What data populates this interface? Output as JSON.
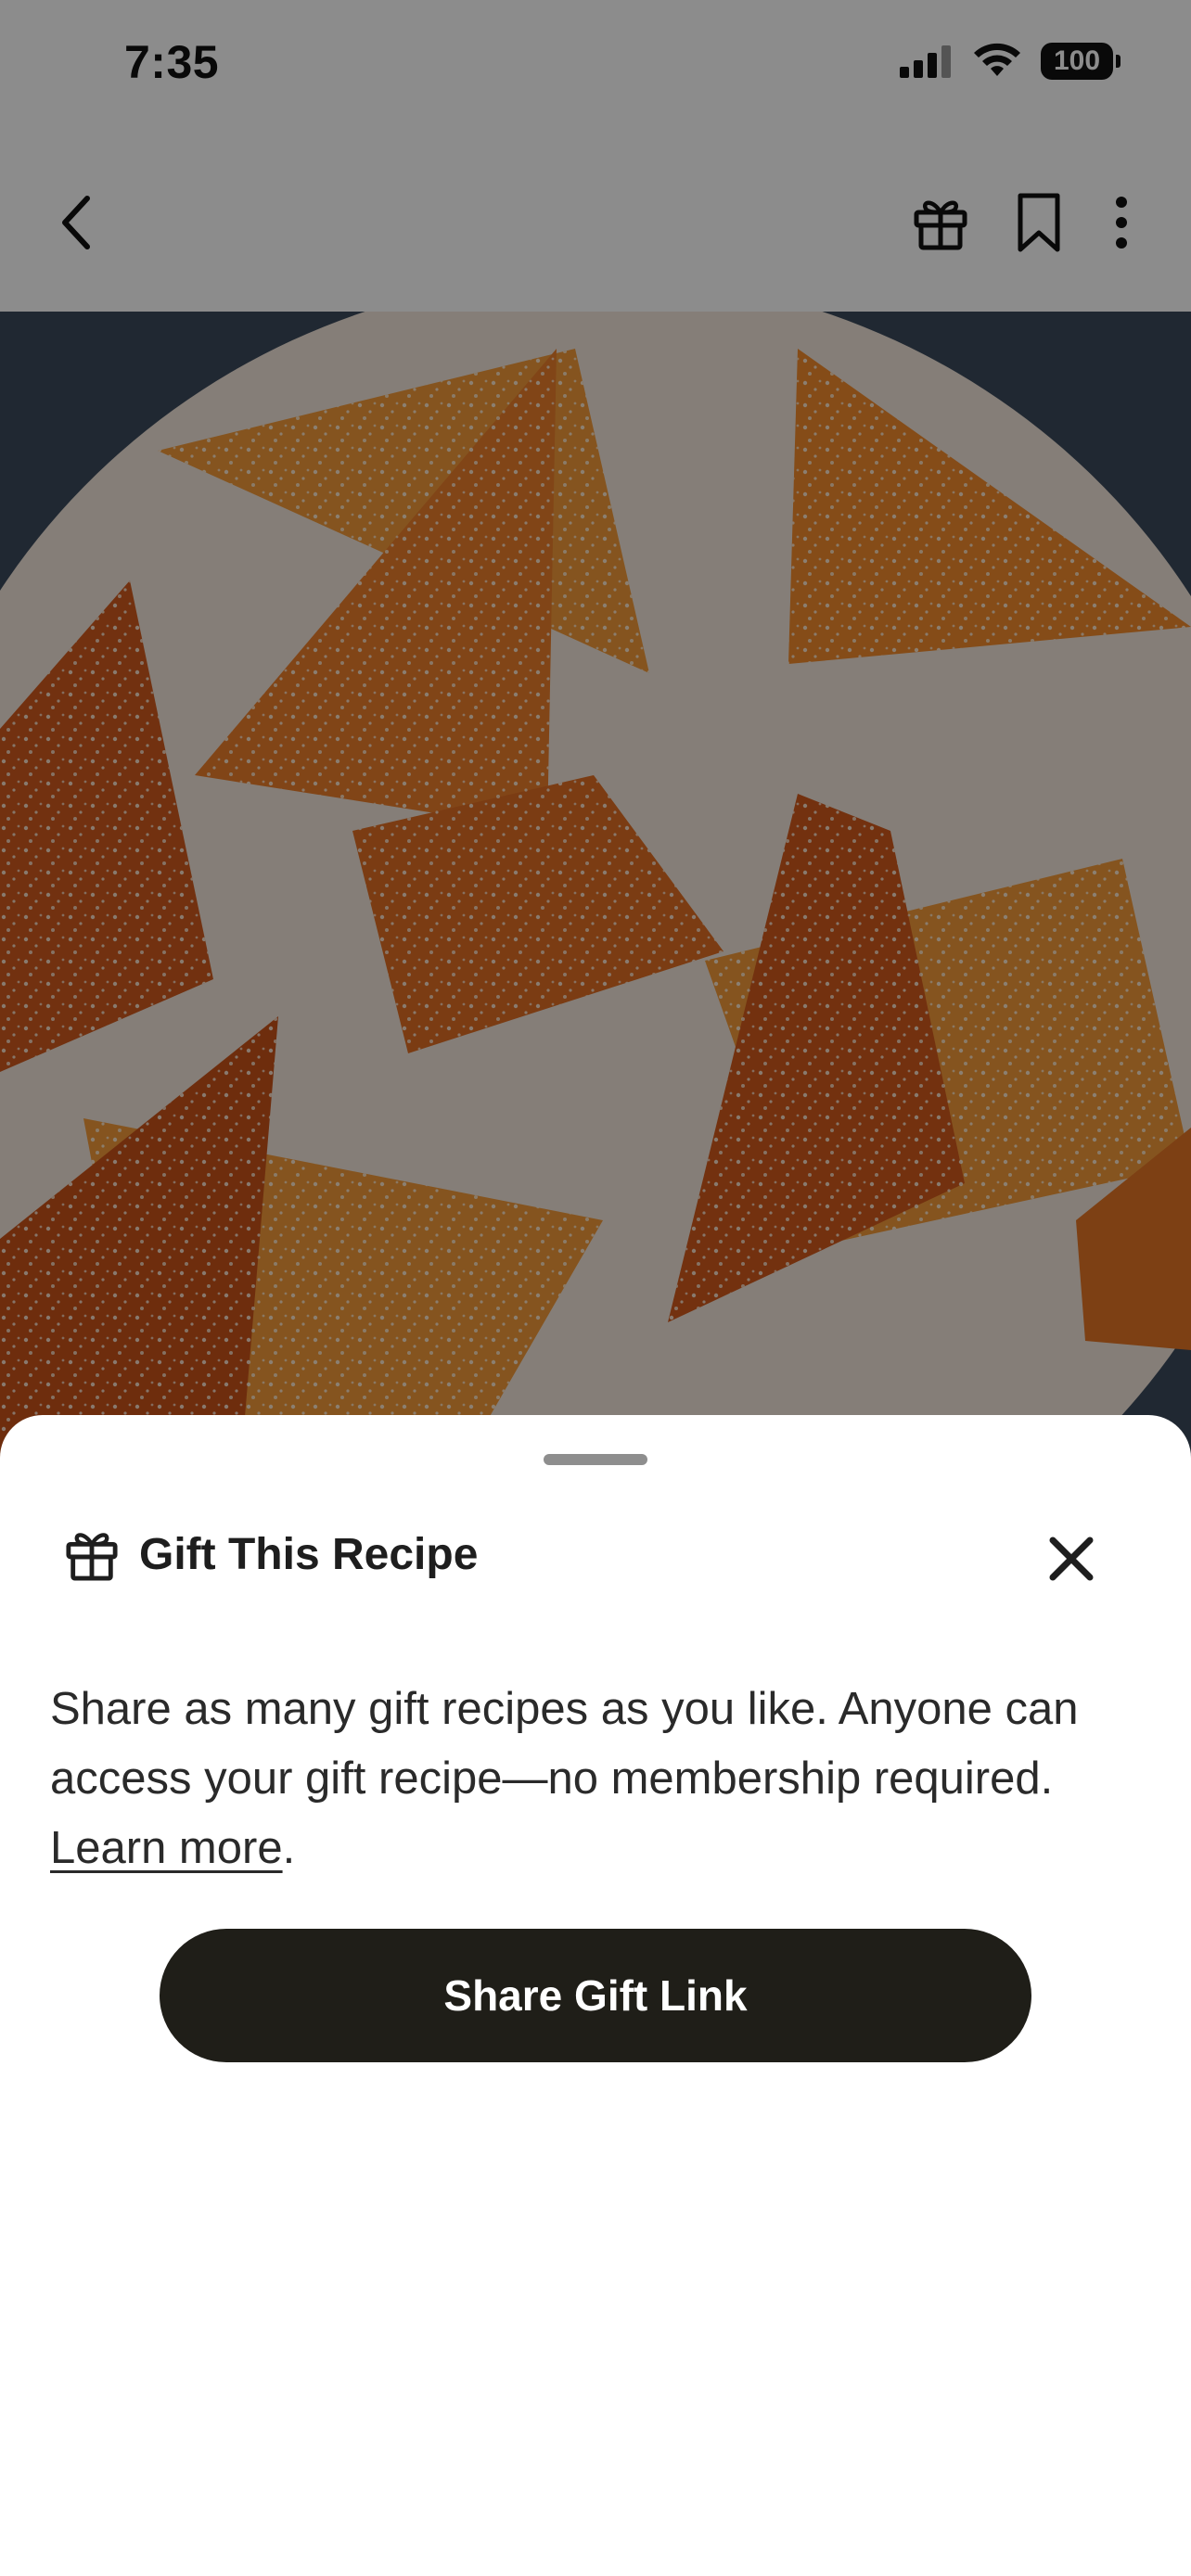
{
  "status_bar": {
    "time": "7:35",
    "battery": "100",
    "icons": [
      "cellular-signal-icon",
      "wifi-icon",
      "battery-icon"
    ]
  },
  "nav": {
    "icons": [
      "back-chevron-icon",
      "gift-icon",
      "bookmark-icon",
      "more-vertical-icon"
    ]
  },
  "hero": {
    "subject": "sugared orange fruit jelly triangles on a plate",
    "colors": {
      "plate": "#efe2d4",
      "jelly_orange": "#f08a2a",
      "jelly_dark": "#d35a1c",
      "background": "#3b4a5c"
    }
  },
  "sheet": {
    "title": "Gift This Recipe",
    "title_icon": "gift-icon",
    "close_icon": "close-icon",
    "body_text": "Share as many gift recipes as you like. Anyone can access your gift recipe—no membership required.",
    "learn_more": "Learn more",
    "after_link": ".",
    "button_label": "Share Gift Link",
    "colors": {
      "button_bg": "#1f1e18",
      "button_text": "#ffffff",
      "text": "#2a2a2a"
    }
  }
}
